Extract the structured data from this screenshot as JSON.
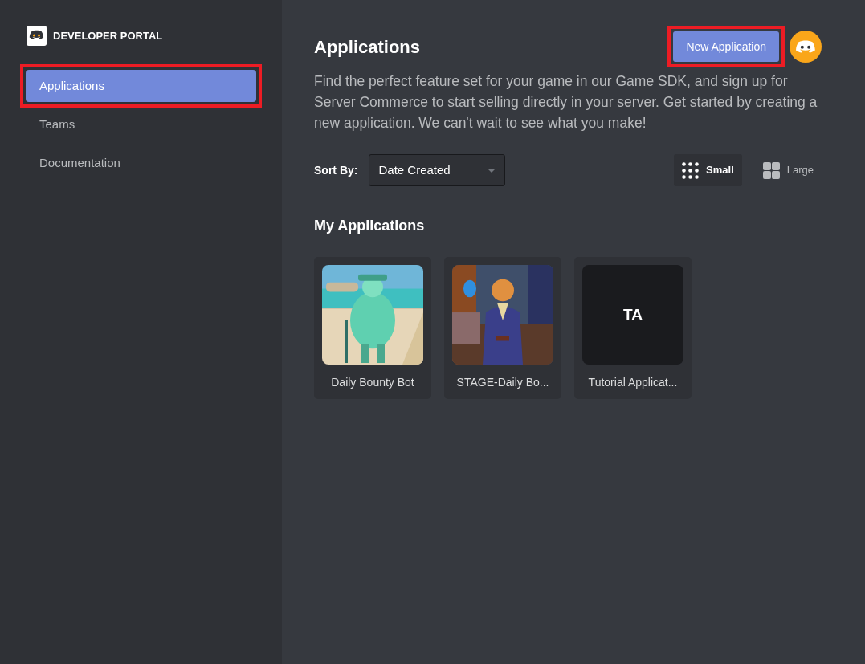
{
  "sidebar": {
    "brand": "DEVELOPER PORTAL",
    "items": [
      {
        "label": "Applications",
        "selected": true,
        "highlighted": true
      },
      {
        "label": "Teams",
        "selected": false,
        "highlighted": false
      },
      {
        "label": "Documentation",
        "selected": false,
        "highlighted": false
      }
    ]
  },
  "header": {
    "title": "Applications",
    "new_button": {
      "label": "New Application",
      "highlighted": true
    }
  },
  "description": "Find the perfect feature set for your game in our Game SDK, and sign up for Server Commerce to start selling directly in your server. Get started by creating a new application. We can't wait to see what you make!",
  "sort": {
    "label": "Sort By:",
    "value": "Date Created"
  },
  "view_toggle": [
    {
      "label": "Small",
      "kind": "dots",
      "selected": true
    },
    {
      "label": "Large",
      "kind": "squares",
      "selected": false
    }
  ],
  "section_title": "My Applications",
  "apps": [
    {
      "name": "Daily Bounty Bot",
      "kind": "picture"
    },
    {
      "name": "STAGE-Daily Bo...",
      "kind": "picture"
    },
    {
      "name": "Tutorial Applicat...",
      "kind": "initials",
      "initials": "TA"
    }
  ]
}
